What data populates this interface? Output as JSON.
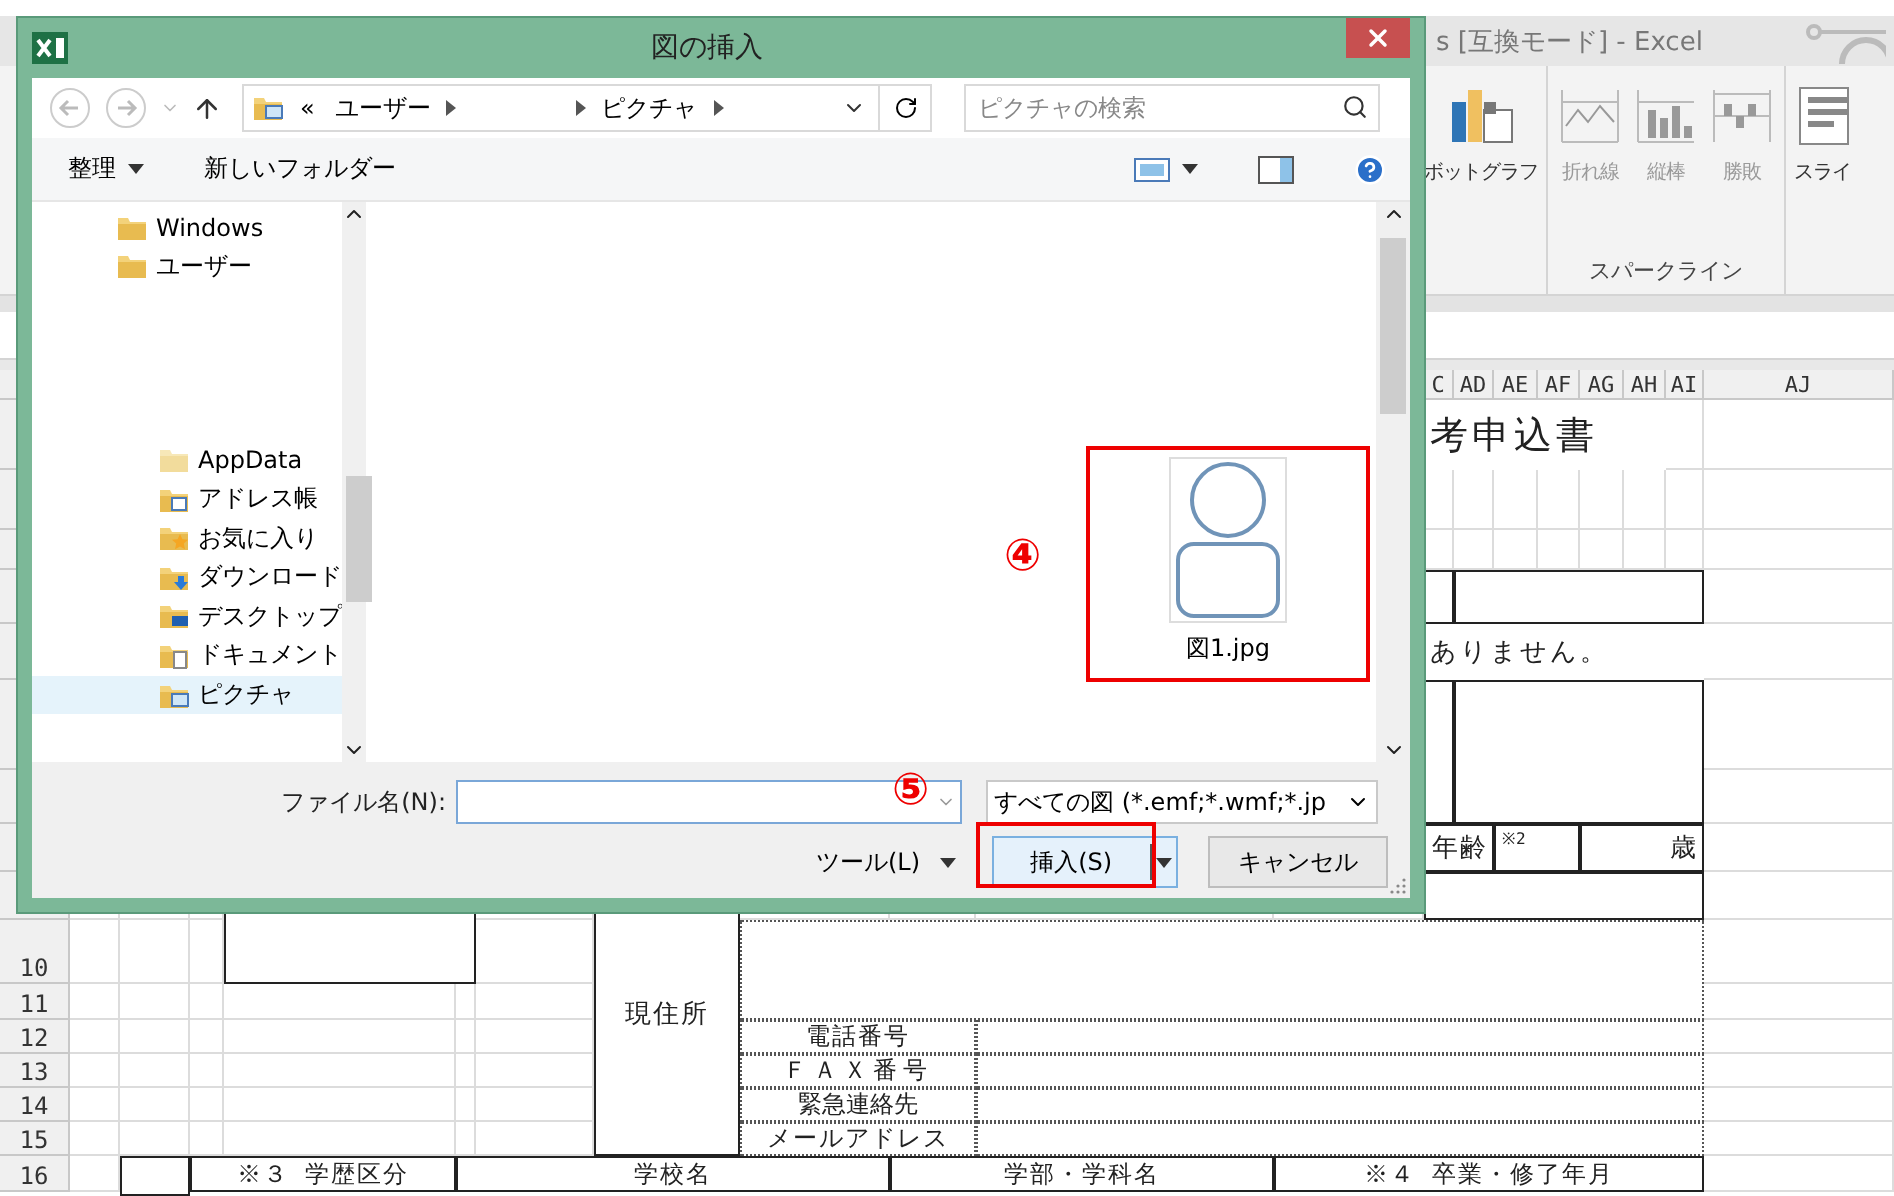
{
  "excel": {
    "title": "s [互換モード] - Excel",
    "ribbon_buttons": [
      {
        "kind": "pivot",
        "label": "ボットグラフ",
        "disabled": false
      },
      {
        "kind": "line",
        "label": "折れ線",
        "disabled": true
      },
      {
        "kind": "column",
        "label": "縦棒",
        "disabled": true
      },
      {
        "kind": "winloss",
        "label": "勝敗",
        "disabled": true
      },
      {
        "kind": "slicer",
        "label": "スライ",
        "disabled": false
      }
    ],
    "group_label": "スパークライン"
  },
  "sheet": {
    "column_headers": [
      "C",
      "AD",
      "AE",
      "AF",
      "AG",
      "AH",
      "AI",
      "AJ"
    ],
    "row_headers": [
      "10",
      "11",
      "12",
      "13",
      "14",
      "15",
      "16"
    ],
    "cells": [
      {
        "text": "考申込書"
      },
      {
        "text": "ありません。"
      },
      {
        "text": "年齢"
      },
      {
        "text": "※2"
      },
      {
        "text": "歳"
      },
      {
        "text": "現住所"
      },
      {
        "text": "電話番号"
      },
      {
        "text": "ＦＡＸ番号"
      },
      {
        "text": "緊急連絡先"
      },
      {
        "text": "メールアドレス"
      },
      {
        "text": "※３ 学歴区分"
      },
      {
        "text": "学校名"
      },
      {
        "text": "学部・学科名"
      },
      {
        "text": "※４ 卒業・修了年月"
      }
    ]
  },
  "dialog": {
    "title": "図の挿入",
    "overflow": "«",
    "breadcrumb": [
      "ユーザー",
      "ピクチャ"
    ],
    "search": {
      "placeholder": "ピクチャの検索"
    },
    "toolbar": {
      "organize": "整理",
      "new_folder": "新しいフォルダー"
    },
    "nav": [
      {
        "label": "Windows",
        "kind": "folder",
        "selected": false
      },
      {
        "label": "ユーザー",
        "kind": "folder",
        "selected": false,
        "children": [
          {
            "label": "AppData",
            "kind": "plain",
            "selected": false
          },
          {
            "label": "アドレス帳",
            "kind": "contacts",
            "selected": false
          },
          {
            "label": "お気に入り",
            "kind": "favorites",
            "selected": false
          },
          {
            "label": "ダウンロード",
            "kind": "downloads",
            "selected": false
          },
          {
            "label": "デスクトップ",
            "kind": "desktop",
            "selected": false
          },
          {
            "label": "ドキュメント",
            "kind": "documents",
            "selected": false
          },
          {
            "label": "ピクチャ",
            "kind": "pictures",
            "selected": true
          }
        ]
      }
    ],
    "files": [
      {
        "name": "図1.jpg"
      }
    ],
    "filename_label": "ファイル名(N):",
    "filter": "すべての図 (*.emf;*.wmf;*.jp",
    "tools": "ツール(L)",
    "insert": "挿入(S)",
    "cancel": "キャンセル",
    "annotations": [
      "④",
      "⑤"
    ]
  }
}
